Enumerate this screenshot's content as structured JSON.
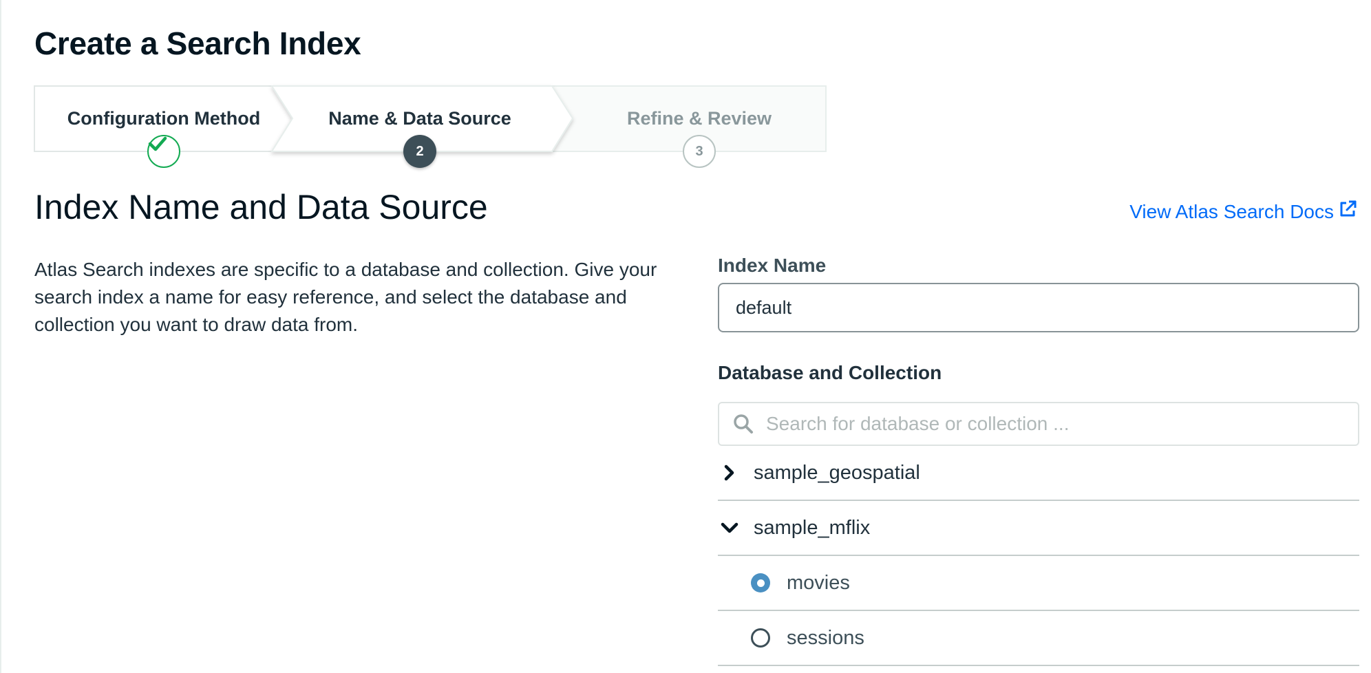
{
  "page": {
    "title": "Create a Search Index"
  },
  "stepper": {
    "steps": [
      {
        "label": "Configuration Method",
        "state": "complete",
        "badge": ""
      },
      {
        "label": "Name & Data Source",
        "state": "active",
        "badge": "2"
      },
      {
        "label": "Refine & Review",
        "state": "pending",
        "badge": "3"
      }
    ]
  },
  "section": {
    "title": "Index Name and Data Source",
    "docs_link": "View Atlas Search Docs",
    "description": "Atlas Search indexes are specific to a database and collection. Give your search index a name for easy reference, and select the database and collection you want to draw data from."
  },
  "form": {
    "index_name_label": "Index Name",
    "index_name_value": "default",
    "db_collection_label": "Database and Collection",
    "search_placeholder": "Search for database or collection ..."
  },
  "tree": {
    "databases": [
      {
        "name": "sample_geospatial",
        "expanded": false
      },
      {
        "name": "sample_mflix",
        "expanded": true
      }
    ],
    "collections": [
      {
        "name": "movies",
        "selected": true
      },
      {
        "name": "sessions",
        "selected": false
      }
    ]
  },
  "colors": {
    "success": "#13aa52",
    "link": "#016bf8",
    "active_badge": "#3d4f58",
    "radio_selected": "#4a90c2"
  }
}
